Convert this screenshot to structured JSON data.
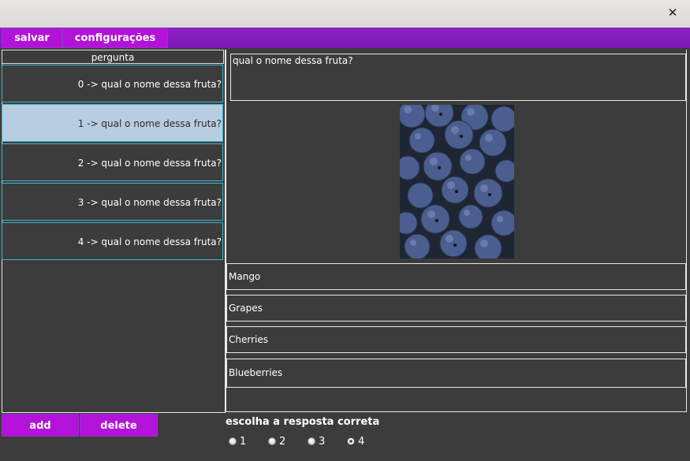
{
  "window": {
    "close_glyph": "✕"
  },
  "menu": {
    "save_label": "salvar",
    "settings_label": "configurações"
  },
  "list": {
    "header": "pergunta",
    "items": [
      {
        "label": "0 -> qual o nome dessa fruta?"
      },
      {
        "label": "1 -> qual o nome dessa fruta?"
      },
      {
        "label": "2 -> qual o nome dessa fruta?"
      },
      {
        "label": "3 -> qual o nome dessa fruta?"
      },
      {
        "label": "4 -> qual o nome dessa fruta?"
      }
    ],
    "selected_index": 1
  },
  "question": {
    "text": "qual o nome dessa fruta?",
    "image": "blueberries-photo",
    "answers": [
      "Mango",
      "Grapes",
      "Cherries",
      "Blueberries"
    ]
  },
  "actions": {
    "add_label": "add",
    "delete_label": "delete"
  },
  "correct_answer": {
    "label": "escolha a resposta correta",
    "options": [
      "1",
      "2",
      "3",
      "4"
    ],
    "selected": "4"
  },
  "colors": {
    "accent": "#b312d9",
    "menubar": "#8519bf",
    "background": "#3c3c3c",
    "selection": "#b8cde2",
    "row_border": "#3fb6c6"
  }
}
